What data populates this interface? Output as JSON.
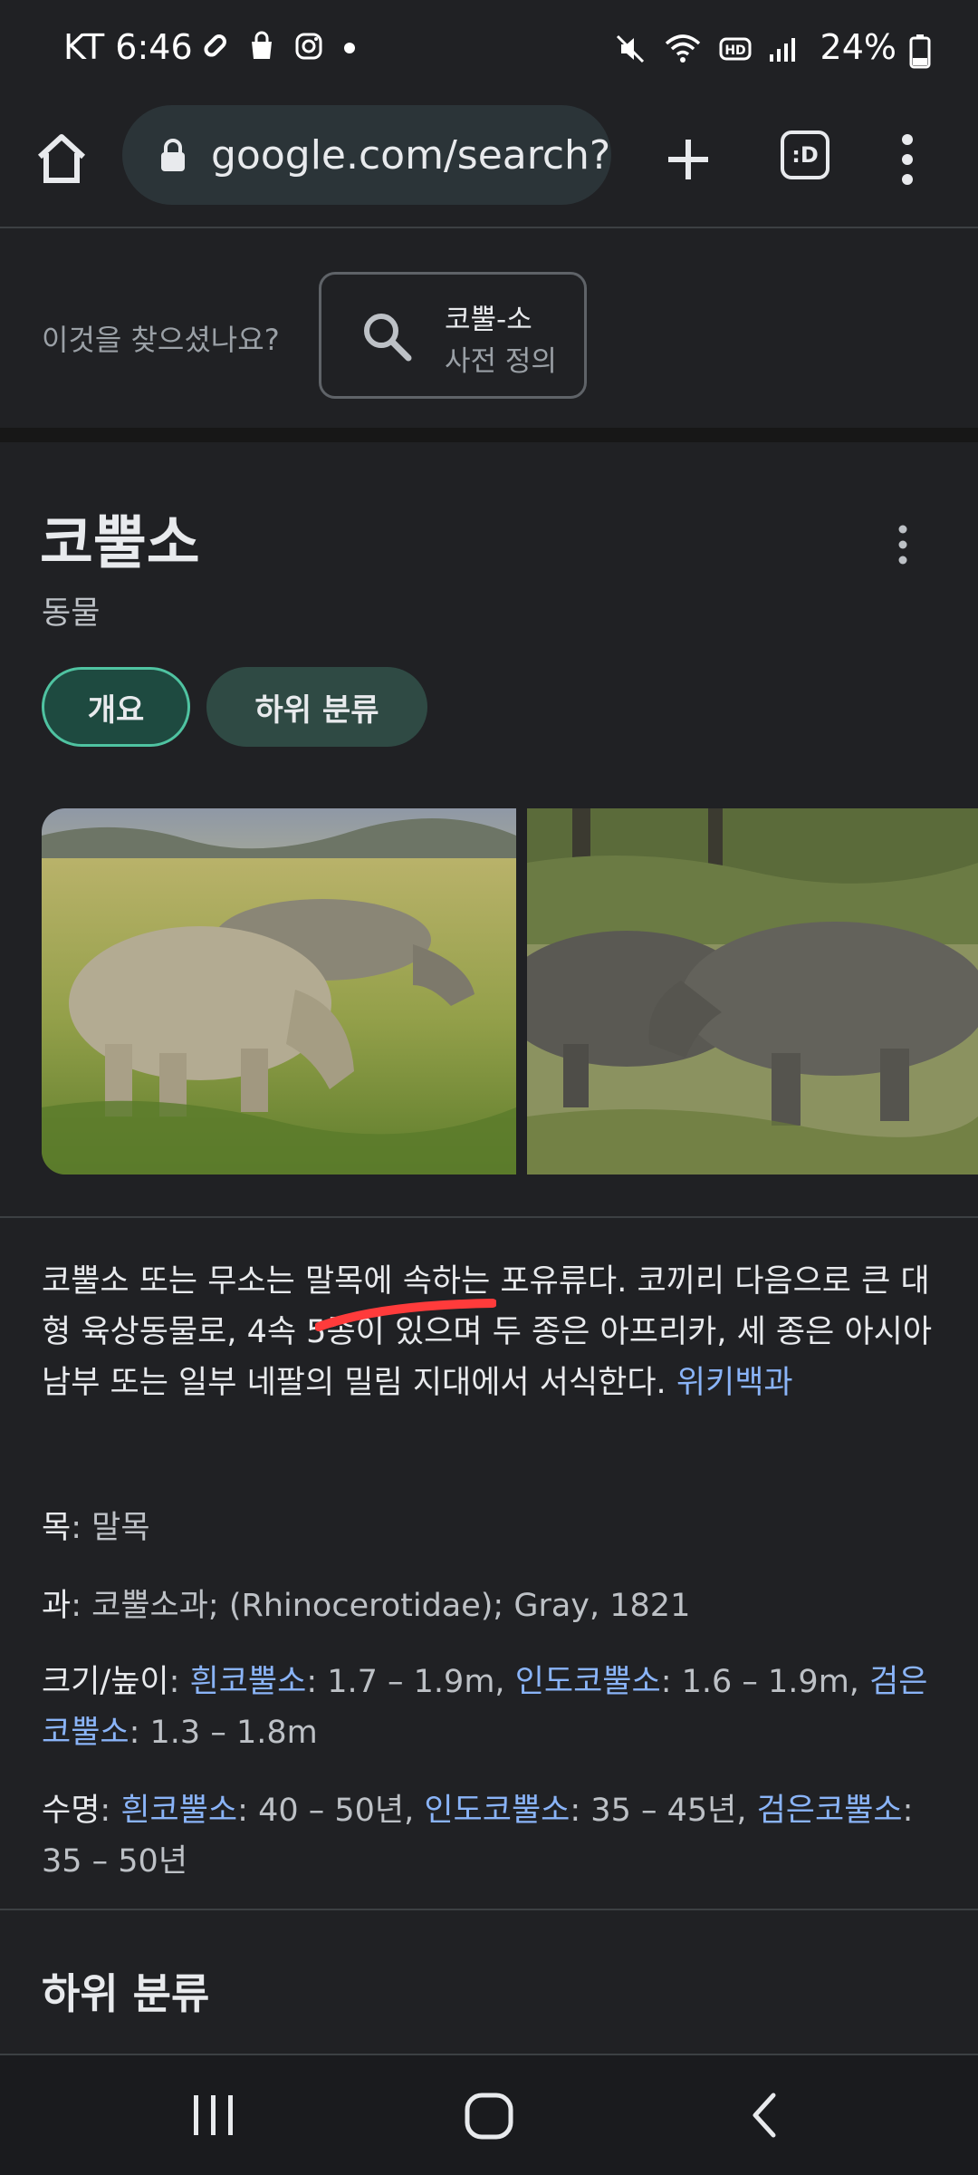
{
  "status_bar": {
    "carrier": "KT",
    "time": "6:46",
    "battery": "24%"
  },
  "browser": {
    "url": "google.com/search?",
    "tab_switcher_label": ":D"
  },
  "did_you_mean": {
    "label": "이것을 찾으셨나요?",
    "chip_title": "코뿔-소",
    "chip_subtitle": "사전 정의"
  },
  "knowledge_panel": {
    "title": "코뿔소",
    "subtitle": "동물",
    "tabs": [
      "개요",
      "하위 분류"
    ],
    "description": {
      "text": "코뿔소 또는 무소는 말목에 속하는 포유류다. 코끼리 다음으로 큰 대형 육상동물로, 4속 5종이 있으며 두 종은 아프리카, 세 종은 아시아 남부 또는 일부 네팔의 밀림 지대에서 서식한다. ",
      "source_link": "위키백과"
    },
    "facts": {
      "order": {
        "key": "목",
        "value": "말목"
      },
      "family": {
        "key": "과",
        "value": "코뿔소과; (Rhinocerotidae); Gray, 1821"
      },
      "size": {
        "key": "크기/높이",
        "items": [
          {
            "name": "흰코뿔소",
            "value": "1.7 – 1.9m"
          },
          {
            "name": "인도코뿔소",
            "value": "1.6 – 1.9m"
          },
          {
            "name": "검은코뿔소",
            "value": "1.3 – 1.8m"
          }
        ]
      },
      "lifespan": {
        "key": "수명",
        "items": [
          {
            "name": "흰코뿔소",
            "value": "40 – 50년"
          },
          {
            "name": "인도코뿔소",
            "value": "35 – 45년"
          },
          {
            "name": "검은코뿔소",
            "value": "35 – 50년"
          }
        ]
      }
    },
    "subsection_heading": "하위 분류"
  },
  "colors": {
    "background": "#202124",
    "link": "#8ab4f8",
    "chip_active_border": "#4fc3a1",
    "annotation_stroke": "#ff3b3b"
  }
}
